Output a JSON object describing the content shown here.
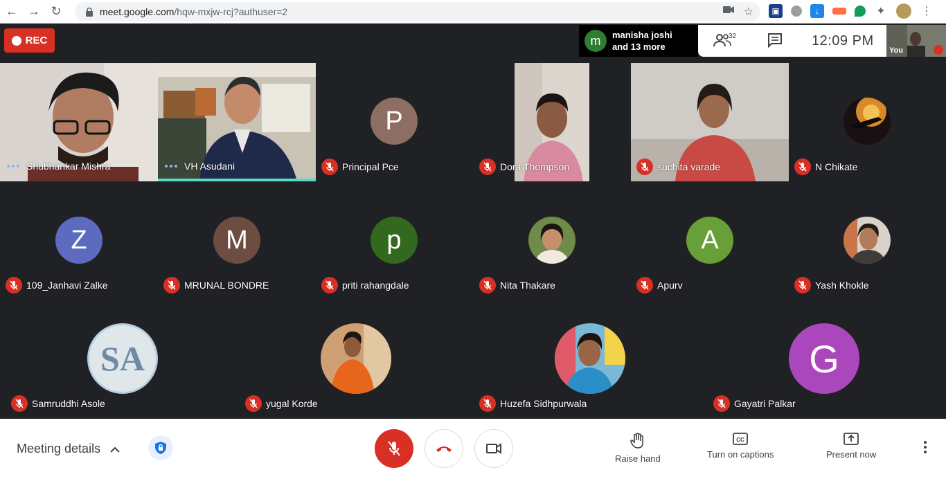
{
  "browser": {
    "url_host": "meet.google.com",
    "url_path": "/hqw-mxjw-rcj?authuser=2"
  },
  "meet": {
    "rec_label": "REC",
    "presenter": {
      "initial": "m",
      "line1": "manisha joshi",
      "line2": "and 13 more"
    },
    "people_count": "32",
    "clock": "12:09  PM",
    "self_label": "You"
  },
  "participants": [
    {
      "name": "Shubhankar Mishra",
      "speaking": true
    },
    {
      "name": "VH Asudani",
      "speaking": true
    },
    {
      "name": "Principal Pce",
      "initial": "P",
      "color": "#8d6e63"
    },
    {
      "name": "Dora Thompson"
    },
    {
      "name": "suchita varade"
    },
    {
      "name": "N Chikate"
    },
    {
      "name": "109_Janhavi Zalke",
      "initial": "Z",
      "color": "#5c6bc0"
    },
    {
      "name": "MRUNAL BONDRE",
      "initial": "M",
      "color": "#6d4c41"
    },
    {
      "name": "priti rahangdale",
      "initial": "p",
      "color": "#33691e"
    },
    {
      "name": "Nita Thakare"
    },
    {
      "name": "Apurv",
      "initial": "A",
      "color": "#689f38"
    },
    {
      "name": "Yash Khokle"
    },
    {
      "name": "Samruddhi Asole",
      "initial": "SA"
    },
    {
      "name": "yugal Korde"
    },
    {
      "name": "Huzefa Sidhpurwala"
    },
    {
      "name": "Gayatri Palkar",
      "initial": "G",
      "color": "#ab47bc"
    }
  ],
  "bottom": {
    "meeting_details": "Meeting details",
    "raise_hand": "Raise hand",
    "captions": "Turn on captions",
    "present": "Present now"
  },
  "colors": {
    "danger": "#d93025",
    "accent": "#1a73e8",
    "background": "#202124"
  }
}
